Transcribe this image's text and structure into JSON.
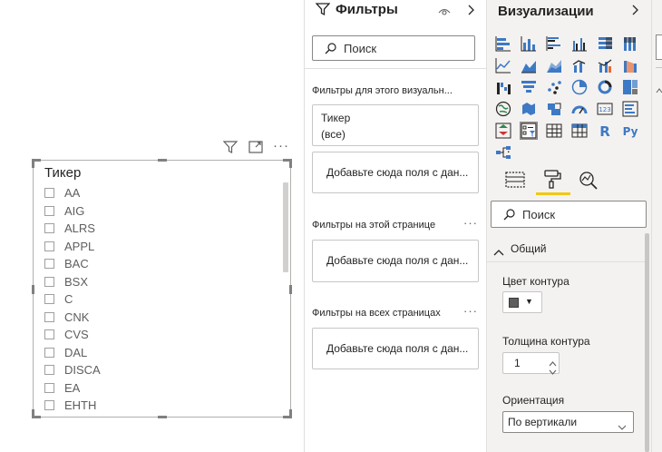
{
  "slicer": {
    "title": "Тикер",
    "items": [
      "AA",
      "AIG",
      "ALRS",
      "APPL",
      "BAC",
      "BSX",
      "C",
      "CNK",
      "CVS",
      "DAL",
      "DISCA",
      "EA",
      "EHTH"
    ]
  },
  "filters_pane": {
    "title": "Фильтры",
    "search_placeholder": "Поиск",
    "visual_section": "Фильтры для этого визуальн...",
    "ticker_card": {
      "field": "Тикер",
      "value": "(все)"
    },
    "drop_text": "Добавьте сюда поля с дан...",
    "page_section": "Фильтры на этой странице",
    "all_pages_section": "Фильтры на всех страницах",
    "more": "···"
  },
  "viz_pane": {
    "title": "Визуализации",
    "more": "···",
    "search_placeholder": "Поиск",
    "format_section": "Общий",
    "outline_color_label": "Цвет контура",
    "outline_color": "#605e5c",
    "outline_width_label": "Толщина контура",
    "outline_width": "1",
    "orientation_label": "Ориентация",
    "orientation_value": "По вертикали"
  },
  "icons": [
    "funnel-icon",
    "focus-mode-icon",
    "more-options-icon",
    "eye-icon",
    "chevron-right-icon",
    "search-icon",
    "paint-roller-icon",
    "fields-icon",
    "analytics-icon",
    "chevron-up-icon"
  ],
  "colors": {
    "accent_yellow": "#f2c811",
    "pane_gray": "#f3f2f1",
    "icon_blue": "#3d79c4"
  }
}
